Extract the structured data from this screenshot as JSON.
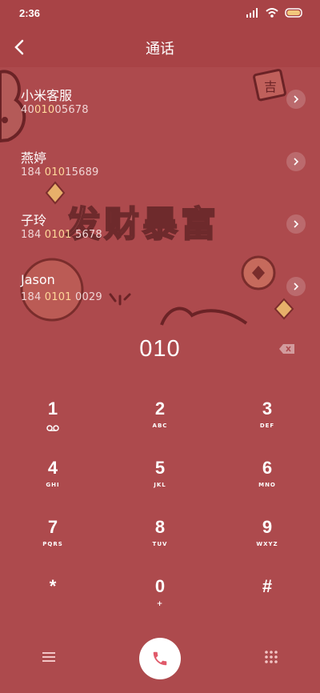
{
  "status": {
    "time": "2:36"
  },
  "header": {
    "title": "通话"
  },
  "banner": {
    "text": "发财暴富",
    "tag": "吉"
  },
  "contacts": [
    {
      "name": "小米客服",
      "num_parts": [
        "40",
        "010",
        "05678"
      ]
    },
    {
      "name": "燕婷",
      "num_parts": [
        "184 ",
        "010",
        "15689"
      ]
    },
    {
      "name": "子玲",
      "num_parts": [
        "184 ",
        "0101",
        " 5678"
      ]
    },
    {
      "name": "Jason",
      "num_parts": [
        "184 ",
        "0101",
        " 0029"
      ]
    }
  ],
  "dialer": {
    "value": "010"
  },
  "keys": [
    {
      "digit": "1",
      "letters": "voicemail-icon"
    },
    {
      "digit": "2",
      "letters": "ABC"
    },
    {
      "digit": "3",
      "letters": "DEF"
    },
    {
      "digit": "4",
      "letters": "GHI"
    },
    {
      "digit": "5",
      "letters": "JKL"
    },
    {
      "digit": "6",
      "letters": "MNO"
    },
    {
      "digit": "7",
      "letters": "PQRS"
    },
    {
      "digit": "8",
      "letters": "TUV"
    },
    {
      "digit": "9",
      "letters": "WXYZ"
    },
    {
      "digit": "*",
      "letters": ""
    },
    {
      "digit": "0",
      "letters": "+"
    },
    {
      "digit": "#",
      "letters": ""
    }
  ],
  "colors": {
    "background": "#ad4a4d",
    "highlight": "#ffd89a",
    "call_icon": "#e05a6a"
  }
}
